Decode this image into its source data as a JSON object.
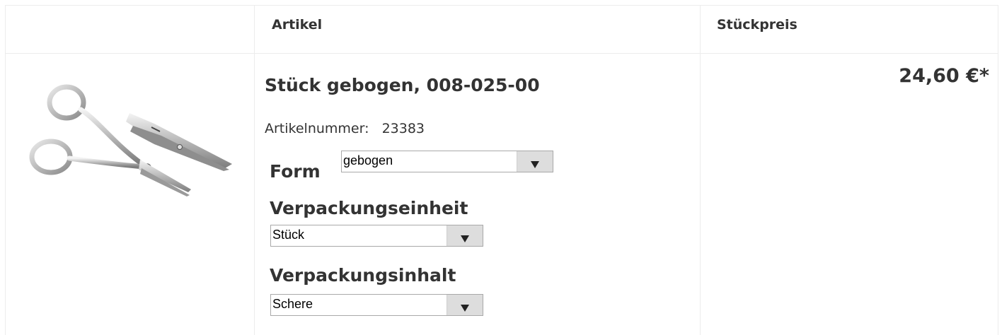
{
  "header": {
    "col_article": "Artikel",
    "col_unit_price": "Stückpreis"
  },
  "product": {
    "image_icon": "scissors-image",
    "title": "Stück gebogen, 008-025-00",
    "sku_label": "Artikelnummer:",
    "sku_value": "23383",
    "price": "24,60 €*"
  },
  "options": {
    "form": {
      "label": "Form",
      "value": "gebogen"
    },
    "packaging_unit": {
      "label": "Verpackungseinheit",
      "value": "Stück"
    },
    "packaging_content": {
      "label": "Verpackungsinhalt",
      "value": "Schere"
    }
  },
  "colors": {
    "border": "#ececec",
    "text": "#333333",
    "select_button": "#dddddd"
  }
}
